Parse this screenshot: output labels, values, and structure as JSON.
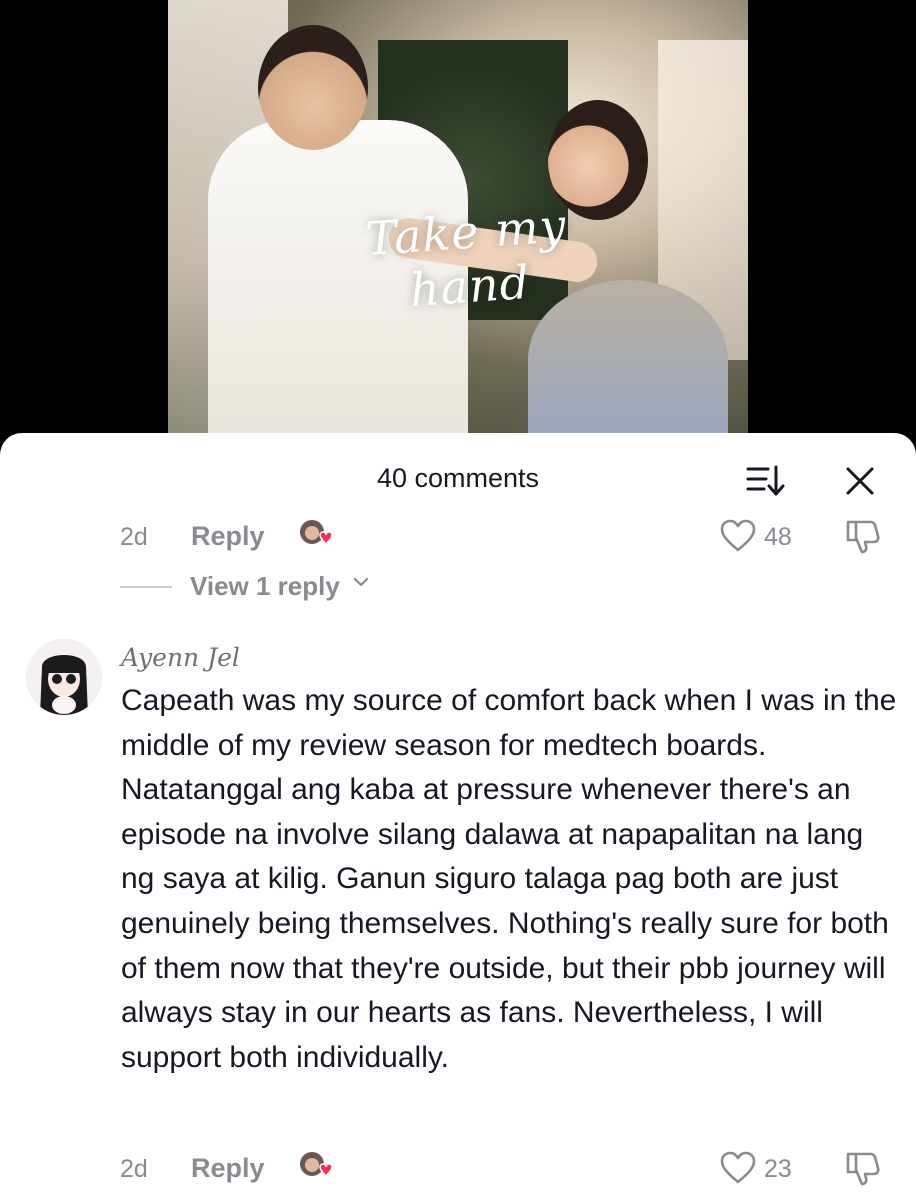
{
  "video": {
    "overlay_text": "Take my hand"
  },
  "panel": {
    "comment_count": "40 comments",
    "icons": {
      "sort": "sort-icon",
      "close": "close-icon"
    }
  },
  "previous_comment": {
    "date": "2d",
    "reply_label": "Reply",
    "likes": "48",
    "view_replies_label": "View 1 reply"
  },
  "comment": {
    "author": "Ayenn Jel",
    "text": "Capeath was my source of comfort back when I was in the middle of my review season for medtech boards. Natatanggal ang kaba at pressure whenever there's an episode na involve silang dalawa at napapalitan na lang ng saya at kilig. Ganun siguro talaga pag both are just genuinely being themselves. Nothing's really sure for both of them now that they're outside, but their pbb journey will always stay in our hearts as fans. Nevertheless, I will support both individually.",
    "date": "2d",
    "reply_label": "Reply",
    "likes": "23"
  },
  "colors": {
    "text_primary": "#161823",
    "text_secondary": "#8a8b91",
    "creator_heart": "#fe2c55"
  }
}
